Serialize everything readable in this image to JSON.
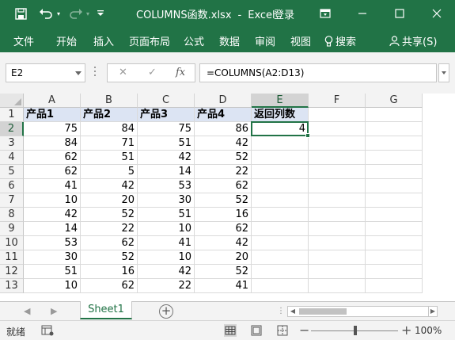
{
  "app": {
    "filename": "COLUMNS函数.xlsx",
    "separator": "-",
    "appname": "Excel",
    "signin": "登录"
  },
  "ribbon": {
    "tabs": [
      "文件",
      "开始",
      "插入",
      "页面布局",
      "公式",
      "数据",
      "审阅",
      "视图"
    ],
    "search": "搜索",
    "share": "共享(S)"
  },
  "formula_bar": {
    "name_box": "E2",
    "formula": "=COLUMNS(A2:D13)",
    "fx": "fx"
  },
  "sheet": {
    "columns": [
      "A",
      "B",
      "C",
      "D",
      "E",
      "F",
      "G"
    ],
    "row_numbers": [
      "1",
      "2",
      "3",
      "4",
      "5",
      "6",
      "7",
      "8",
      "9",
      "10",
      "11",
      "12",
      "13"
    ],
    "header_row": [
      "产品1",
      "产品2",
      "产品3",
      "产品4",
      "返回列数"
    ],
    "rows": [
      [
        75,
        84,
        75,
        86,
        4
      ],
      [
        84,
        71,
        51,
        42,
        null
      ],
      [
        62,
        51,
        42,
        52,
        null
      ],
      [
        62,
        5,
        14,
        22,
        null
      ],
      [
        41,
        42,
        53,
        62,
        null
      ],
      [
        10,
        20,
        30,
        52,
        null
      ],
      [
        42,
        52,
        51,
        16,
        null
      ],
      [
        14,
        22,
        10,
        62,
        null
      ],
      [
        53,
        62,
        41,
        42,
        null
      ],
      [
        30,
        52,
        10,
        20,
        null
      ],
      [
        51,
        16,
        42,
        52,
        null
      ],
      [
        10,
        62,
        22,
        41,
        null
      ]
    ],
    "selected_cell": "E2",
    "tab_name": "Sheet1"
  },
  "status": {
    "ready": "就绪",
    "zoom": "100%",
    "zoom_minus": "−",
    "zoom_plus": "+"
  },
  "colors": {
    "accent": "#217346",
    "header_fill": "#dce4f3"
  }
}
